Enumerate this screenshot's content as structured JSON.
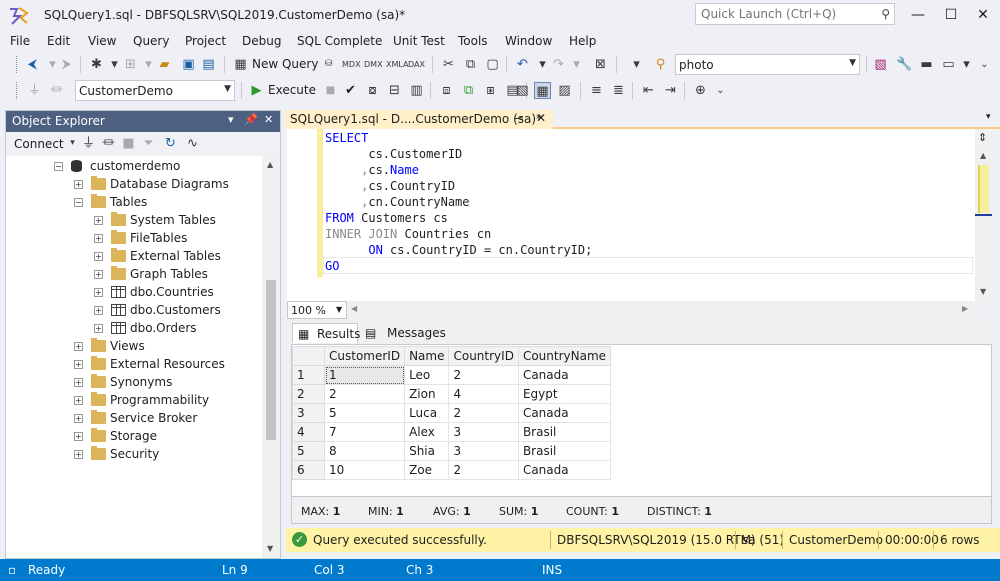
{
  "window": {
    "title": "SQLQuery1.sql - DBFSQLSRV\\SQL2019.CustomerDemo (sa)*",
    "quick_launch_placeholder": "Quick Launch (Ctrl+Q)"
  },
  "menu": [
    "File",
    "Edit",
    "View",
    "Query",
    "Project",
    "Debug",
    "SQL Complete",
    "Unit Test",
    "Tools",
    "Window",
    "Help"
  ],
  "toolbar1": {
    "new_query_label": "New Query",
    "search_combo_value": "photo"
  },
  "toolbar2": {
    "database_combo_value": "CustomerDemo",
    "execute_label": "Execute"
  },
  "object_explorer": {
    "title": "Object Explorer",
    "connect_label": "Connect",
    "tree": [
      {
        "label": "customerdemo",
        "level": 0,
        "expander": "−",
        "icon": "database-icon"
      },
      {
        "label": "Database Diagrams",
        "level": 1,
        "expander": "+",
        "icon": "folder-icon"
      },
      {
        "label": "Tables",
        "level": 1,
        "expander": "−",
        "icon": "folder-icon"
      },
      {
        "label": "System Tables",
        "level": 2,
        "expander": "+",
        "icon": "folder-icon"
      },
      {
        "label": "FileTables",
        "level": 2,
        "expander": "+",
        "icon": "folder-icon"
      },
      {
        "label": "External Tables",
        "level": 2,
        "expander": "+",
        "icon": "folder-icon"
      },
      {
        "label": "Graph Tables",
        "level": 2,
        "expander": "+",
        "icon": "folder-icon"
      },
      {
        "label": "dbo.Countries",
        "level": 2,
        "expander": "+",
        "icon": "table-icon"
      },
      {
        "label": "dbo.Customers",
        "level": 2,
        "expander": "+",
        "icon": "table-icon"
      },
      {
        "label": "dbo.Orders",
        "level": 2,
        "expander": "+",
        "icon": "table-icon"
      },
      {
        "label": "Views",
        "level": 1,
        "expander": "+",
        "icon": "folder-icon"
      },
      {
        "label": "External Resources",
        "level": 1,
        "expander": "+",
        "icon": "folder-icon"
      },
      {
        "label": "Synonyms",
        "level": 1,
        "expander": "+",
        "icon": "folder-icon"
      },
      {
        "label": "Programmability",
        "level": 1,
        "expander": "+",
        "icon": "folder-icon"
      },
      {
        "label": "Service Broker",
        "level": 1,
        "expander": "+",
        "icon": "folder-icon"
      },
      {
        "label": "Storage",
        "level": 1,
        "expander": "+",
        "icon": "folder-icon"
      },
      {
        "label": "Security",
        "level": 1,
        "expander": "+",
        "icon": "folder-icon"
      }
    ]
  },
  "editor": {
    "tab_label": "SQLQuery1.sql - D....CustomerDemo (sa)*",
    "zoom": "100 %",
    "code": {
      "l1": "SELECT",
      "l2_col": "cs.CustomerID",
      "l3_prefix": "cs.",
      "l3_col": "Name",
      "l4_col": "cs.CountryID",
      "l5_col": "cn.CountryName",
      "l6_from": "FROM",
      "l6_rest": "Customers cs",
      "l7_join": "INNER JOIN",
      "l7_rest": "Countries cn",
      "l8_on": "ON",
      "l8_rest": "cs.CountryID = cn.CountryID;",
      "l9": "GO"
    }
  },
  "results": {
    "tabs": [
      "Results",
      "Messages"
    ],
    "columns": [
      "CustomerID",
      "Name",
      "CountryID",
      "CountryName"
    ],
    "rows": [
      [
        "1",
        "1",
        "Leo",
        "2",
        "Canada"
      ],
      [
        "2",
        "2",
        "Zion",
        "4",
        "Egypt"
      ],
      [
        "3",
        "5",
        "Luca",
        "2",
        "Canada"
      ],
      [
        "4",
        "7",
        "Alex",
        "3",
        "Brasil"
      ],
      [
        "5",
        "8",
        "Shia",
        "3",
        "Brasil"
      ],
      [
        "6",
        "10",
        "Zoe",
        "2",
        "Canada"
      ]
    ],
    "stats": [
      {
        "label": "MAX:",
        "value": "1"
      },
      {
        "label": "MIN:",
        "value": "1"
      },
      {
        "label": "AVG:",
        "value": "1"
      },
      {
        "label": "SUM:",
        "value": "1"
      },
      {
        "label": "COUNT:",
        "value": "1"
      },
      {
        "label": "DISTINCT:",
        "value": "1"
      }
    ]
  },
  "query_status": {
    "message": "Query executed successfully.",
    "server": "DBFSQLSRV\\SQL2019 (15.0 RTM)",
    "user": "sa (51)",
    "database": "CustomerDemo",
    "elapsed": "00:00:00",
    "rows": "6 rows"
  },
  "status_bar": {
    "ready": "Ready",
    "ln": "Ln 9",
    "col": "Col 3",
    "ch": "Ch 3",
    "mode": "INS"
  },
  "colors": {
    "status_bar": "#007acc",
    "panel_header": "#4d6082",
    "query_status": "#fff3a6",
    "keyword": "#0000ff"
  }
}
